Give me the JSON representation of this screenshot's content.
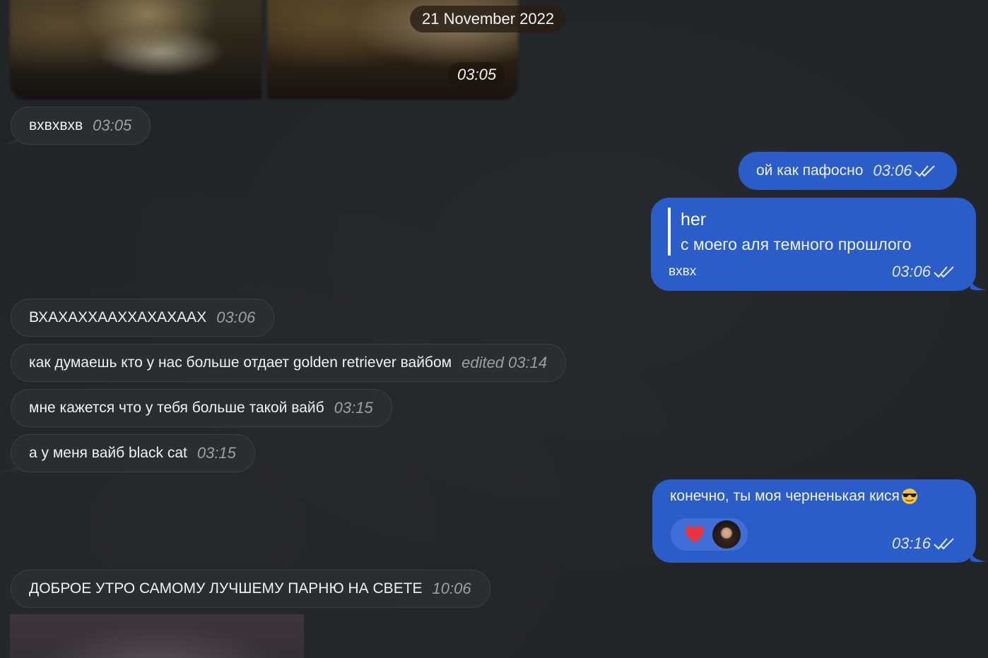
{
  "date_badge": "21 November 2022",
  "photo_group_time": "03:05",
  "messages": [
    {
      "side": "in",
      "text": "вхвхвхв",
      "time": "03:05"
    },
    {
      "side": "out",
      "text": "ой как пафосно",
      "time": "03:06",
      "status": "read"
    },
    {
      "side": "out",
      "reply_author": "her",
      "reply_text": "с моего аля темного прошлого",
      "text": "вхвх",
      "time": "03:06",
      "status": "read"
    },
    {
      "side": "in",
      "text": "ВХАХАХХААХХАХАХААХ",
      "time": "03:06"
    },
    {
      "side": "in",
      "text": "как думаешь кто у нас больше отдает golden retriever вайбом",
      "edited": "edited",
      "time": "03:14"
    },
    {
      "side": "in",
      "text": "мне кажется что у тебя больше такой вайб",
      "time": "03:15"
    },
    {
      "side": "in",
      "text": "а у меня вайб black cat",
      "time": "03:15"
    },
    {
      "side": "out",
      "text": "конечно, ты моя черненькая кися",
      "emoji": "sunglasses-emoji",
      "reaction": "heart-icon",
      "time": "03:16",
      "status": "read"
    },
    {
      "side": "in",
      "text": "ДОБРОЕ УТРО САМОМУ ЛУЧШЕМУ ПАРНЮ НА СВЕТЕ",
      "time": "10:06"
    }
  ],
  "colors": {
    "background": "#222528",
    "incoming_bubble": "#2b2e31",
    "outgoing_bubble": "#2b5dc9",
    "reaction_heart": "#e8343f"
  }
}
